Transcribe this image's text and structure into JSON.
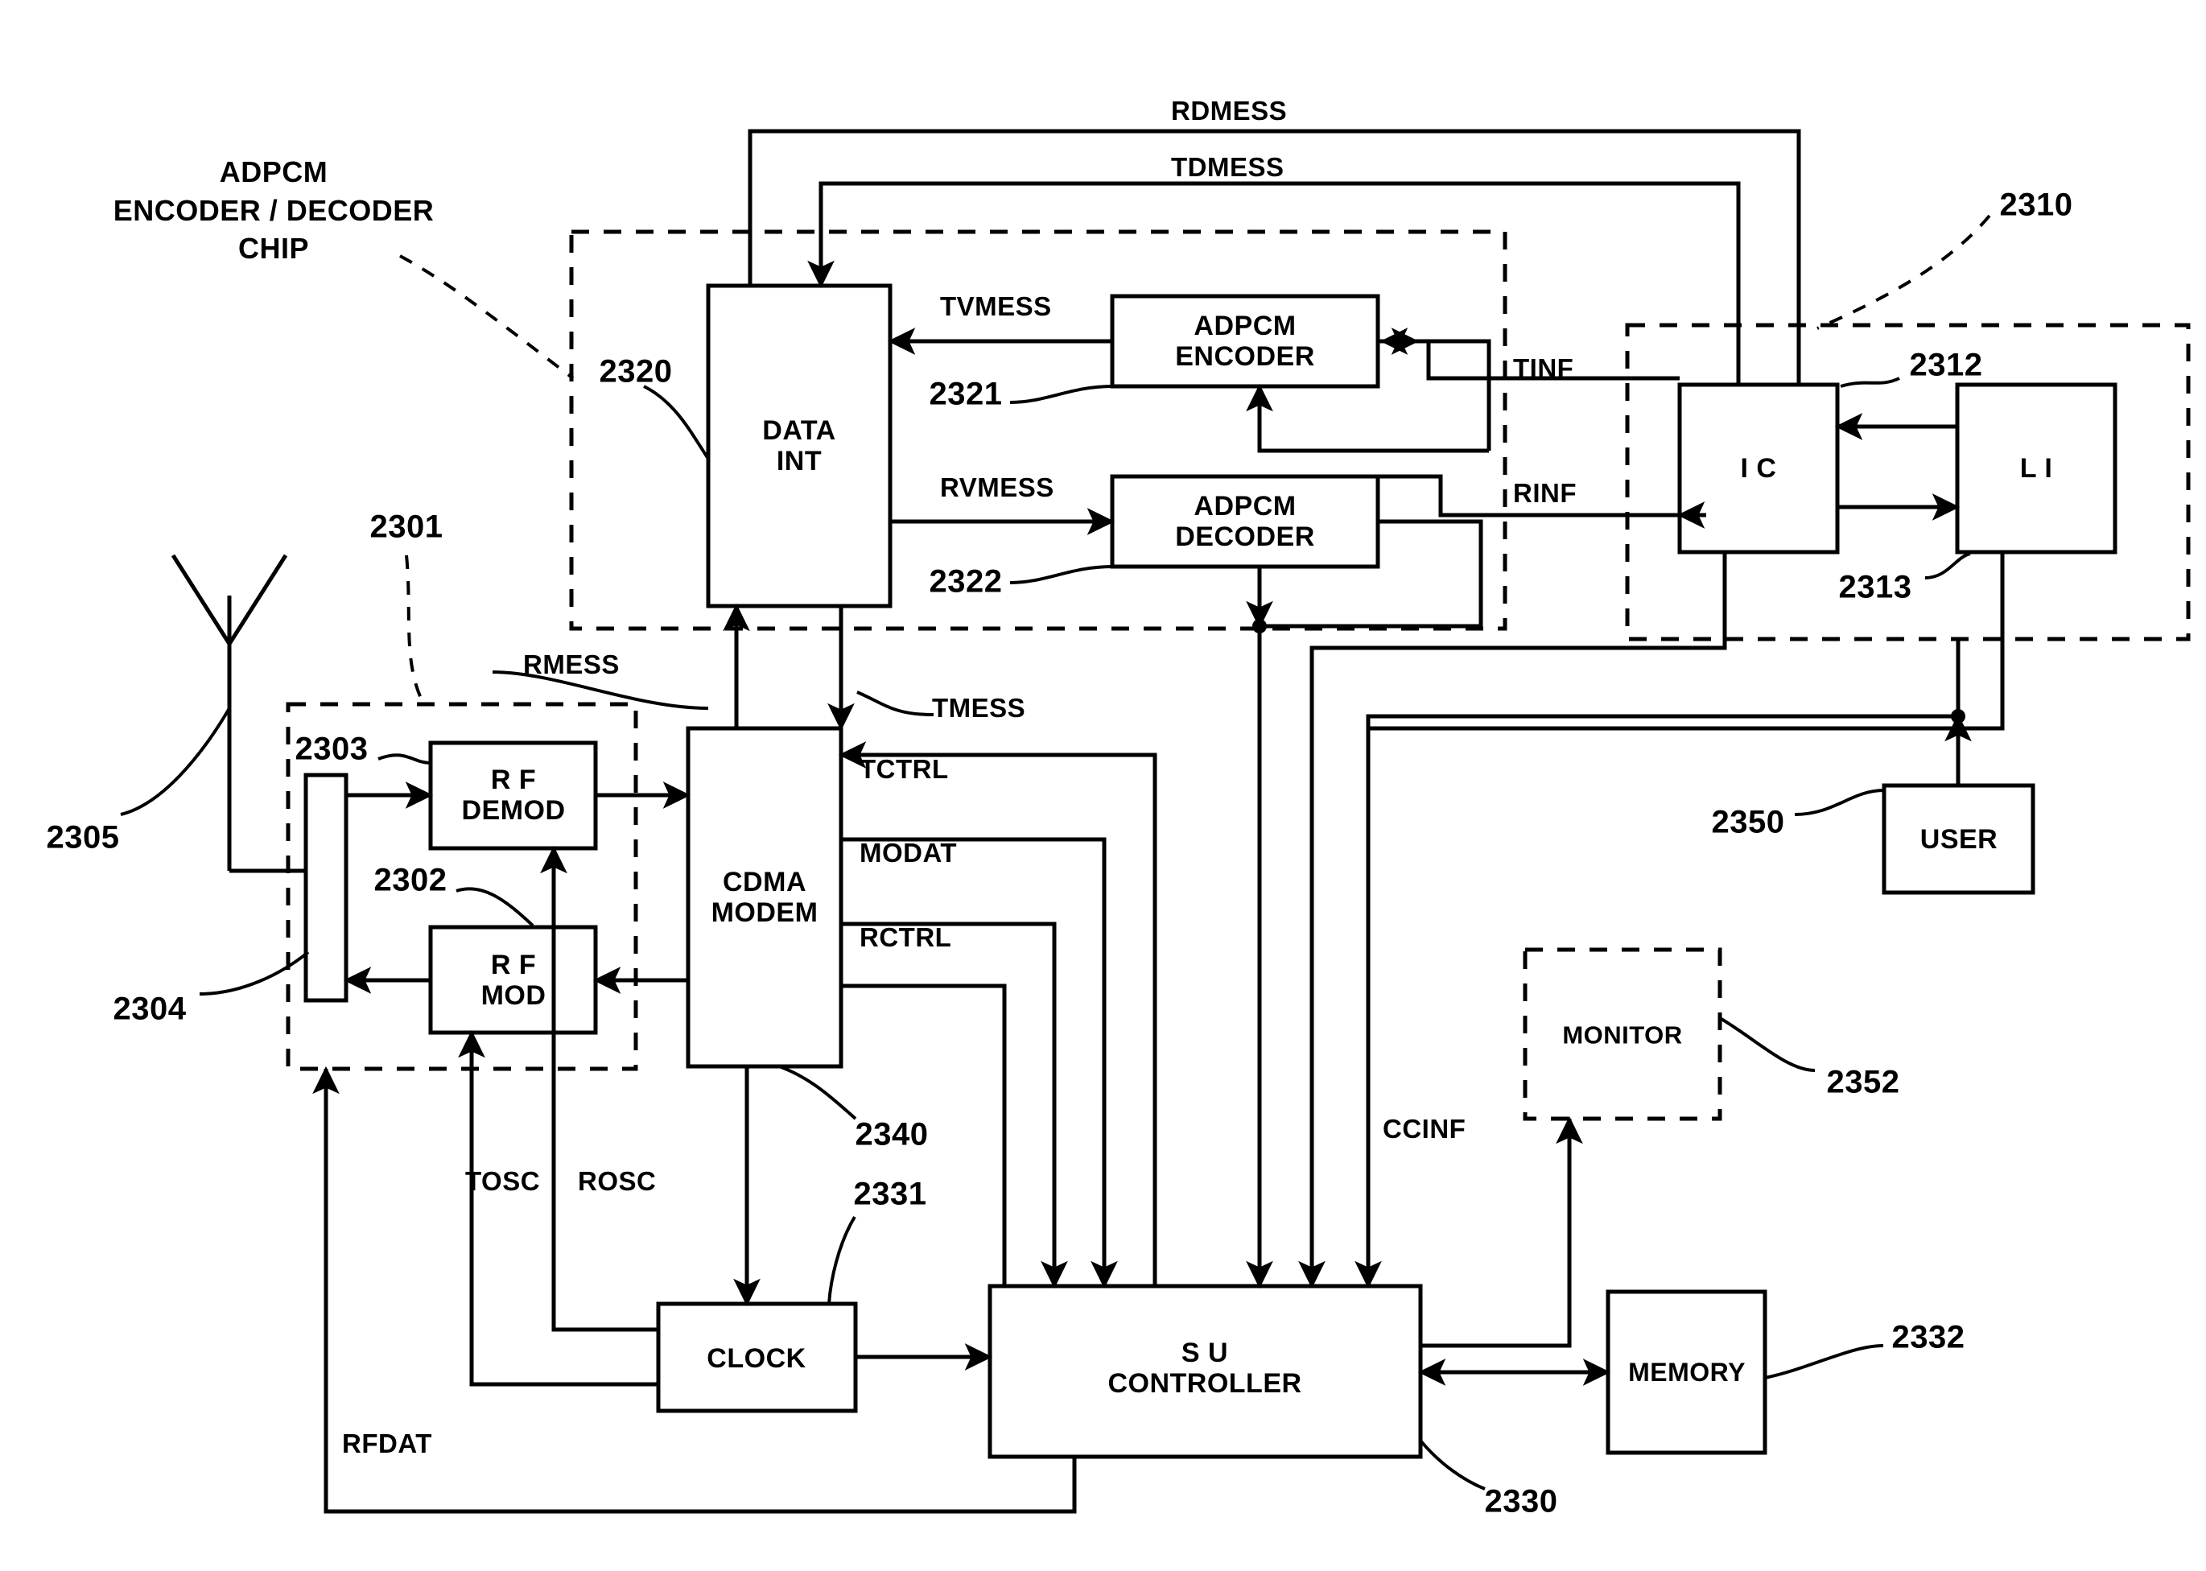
{
  "figure": {
    "type": "patent-block-diagram",
    "title_annotation": "ADPCM\nENCODER / DECODER\nCHIP"
  },
  "blocks": [
    {
      "id": "data_int",
      "label": "DATA\nINT",
      "ref": "2320",
      "style": "solid"
    },
    {
      "id": "adpcm_encoder",
      "label": "ADPCM\nENCODER",
      "ref": "2321",
      "style": "solid"
    },
    {
      "id": "adpcm_decoder",
      "label": "ADPCM\nDECODER",
      "ref": "2322",
      "style": "solid"
    },
    {
      "id": "ic",
      "label": "I C",
      "ref": "2312",
      "style": "solid"
    },
    {
      "id": "li",
      "label": "L I",
      "ref": "2313",
      "style": "solid"
    },
    {
      "id": "rf_demod",
      "label": "R F\nDEMOD",
      "ref": "2303",
      "style": "solid"
    },
    {
      "id": "rf_mod",
      "label": "R F\nMOD",
      "ref": "2302",
      "style": "solid"
    },
    {
      "id": "duplexer",
      "label": "",
      "ref": "2304",
      "style": "solid"
    },
    {
      "id": "antenna",
      "label": "",
      "ref": "2305",
      "style": "antenna"
    },
    {
      "id": "cdma_modem",
      "label": "CDMA\nMODEM",
      "ref": "2340",
      "style": "solid"
    },
    {
      "id": "clock",
      "label": "CLOCK",
      "ref": "2331",
      "style": "solid"
    },
    {
      "id": "su_controller",
      "label": "S U\nCONTROLLER",
      "ref": "2330",
      "style": "solid"
    },
    {
      "id": "memory",
      "label": "MEMORY",
      "ref": "2332",
      "style": "solid"
    },
    {
      "id": "user",
      "label": "USER",
      "ref": "2350",
      "style": "solid"
    },
    {
      "id": "monitor",
      "label": "MONITOR",
      "ref": "2352",
      "style": "dashed"
    }
  ],
  "block_labels": {
    "data_int": "DATA\nINT",
    "adpcm_encoder": "ADPCM\nENCODER",
    "adpcm_decoder": "ADPCM\nDECODER",
    "ic": "I C",
    "li": "L I",
    "rf_demod": "R F\nDEMOD",
    "rf_mod": "R F\nMOD",
    "cdma_modem": "CDMA\nMODEM",
    "clock": "CLOCK",
    "su_controller": "S U\nCONTROLLER",
    "memory": "MEMORY",
    "user": "USER",
    "monitor": "MONITOR"
  },
  "reference_numerals": {
    "chip_group": "2301",
    "rf_mod": "2302",
    "rf_demod": "2303",
    "duplexer": "2304",
    "antenna": "2305",
    "network_group": "2310",
    "ic": "2312",
    "li": "2313",
    "data_int": "2320",
    "adpcm_encoder": "2321",
    "adpcm_decoder": "2322",
    "su_controller": "2330",
    "clock": "2331",
    "memory": "2332",
    "cdma_modem": "2340",
    "user": "2350",
    "monitor": "2352"
  },
  "signals": [
    {
      "name": "RDMESS",
      "from": "ic",
      "to": "data_int"
    },
    {
      "name": "TDMESS",
      "from": "data_int",
      "to": "ic"
    },
    {
      "name": "TVMESS",
      "from": "adpcm_encoder",
      "to": "data_int"
    },
    {
      "name": "RVMESS",
      "from": "data_int",
      "to": "adpcm_decoder"
    },
    {
      "name": "TINF",
      "from": "adpcm_encoder",
      "to": "ic"
    },
    {
      "name": "RINF",
      "from": "ic",
      "to": "adpcm_decoder"
    },
    {
      "name": "RMESS",
      "from": "cdma_modem",
      "to": "data_int"
    },
    {
      "name": "TMESS",
      "from": "data_int",
      "to": "cdma_modem"
    },
    {
      "name": "TCTRL",
      "from": "su_controller",
      "to": "cdma_modem"
    },
    {
      "name": "MODAT",
      "from": "cdma_modem",
      "to": "su_controller"
    },
    {
      "name": "RCTRL",
      "from": "cdma_modem",
      "to": "su_controller"
    },
    {
      "name": "TOSC",
      "from": "clock",
      "to": "rf_mod"
    },
    {
      "name": "ROSC",
      "from": "clock",
      "to": "rf_demod"
    },
    {
      "name": "RFDAT",
      "from": "su_controller",
      "to": "duplexer"
    },
    {
      "name": "CCINF",
      "from": "su_controller",
      "to": "monitor"
    }
  ],
  "signal_labels": {
    "rdmess": "RDMESS",
    "tdmess": "TDMESS",
    "tvmess": "TVMESS",
    "rvmess": "RVMESS",
    "tinf": "TINF",
    "rinf": "RINF",
    "rmess": "RMESS",
    "tmess": "TMESS",
    "tctrl": "TCTRL",
    "modat": "MODAT",
    "rctrl": "RCTRL",
    "tosc": "TOSC",
    "rosc": "ROSC",
    "rfdat": "RFDAT",
    "ccinf": "CCINF"
  },
  "colors": {
    "stroke": "#000000",
    "background": "#ffffff"
  }
}
